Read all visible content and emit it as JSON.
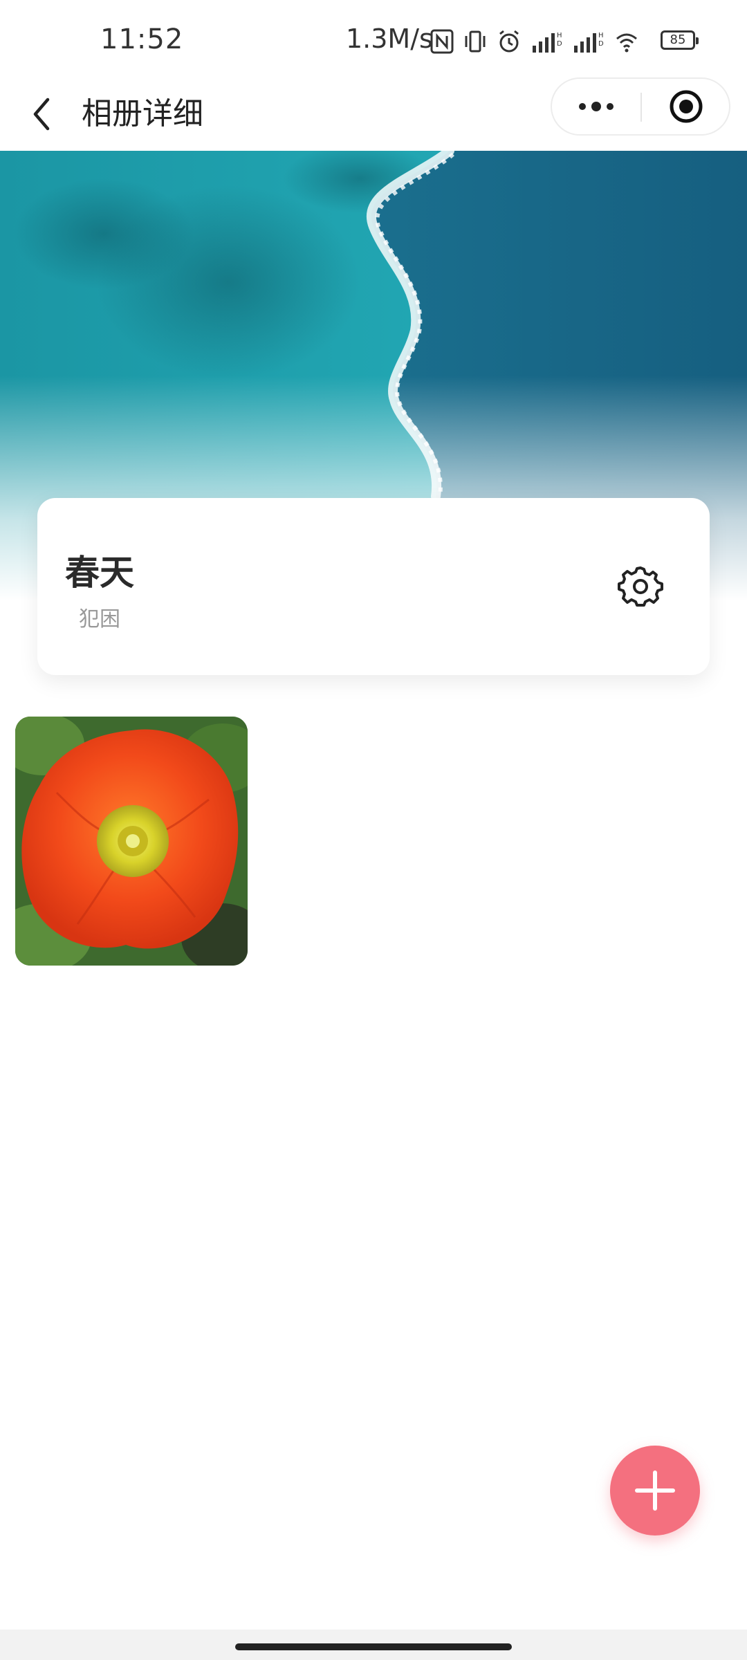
{
  "status_bar": {
    "time": "11:52",
    "network_speed": "1.3M/s",
    "battery": "85",
    "icons": [
      "nfc-icon",
      "vibrate-icon",
      "alarm-icon",
      "signal-icon",
      "signal-icon",
      "wifi-icon",
      "battery-icon"
    ]
  },
  "nav": {
    "title": "相册详细",
    "back_icon": "chevron-left-icon",
    "more_icon": "more-dots-icon",
    "close_icon": "target-circle-icon"
  },
  "album": {
    "name": "春天",
    "description": "犯困",
    "settings_icon": "gear-icon"
  },
  "photos": [
    {
      "subject": "red-poppy-flower"
    }
  ],
  "fab": {
    "icon": "plus-icon",
    "color": "#f4707f"
  },
  "colors": {
    "accent": "#f4707f",
    "text_primary": "#2a2a2a",
    "text_secondary": "#999999"
  }
}
